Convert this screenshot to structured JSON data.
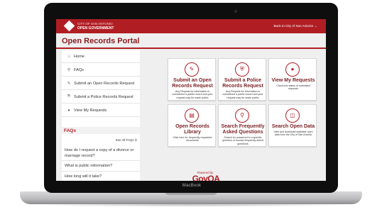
{
  "header": {
    "logo_line1": "CITY OF SAN ANTONIO",
    "logo_line2": "OPEN GOVERNMENT",
    "back_link": "Back to City of San Antonio →"
  },
  "page_title": "Open Records Portal",
  "nav": [
    {
      "icon": "home-icon",
      "label": "Home"
    },
    {
      "icon": "search-icon",
      "label": "FAQs"
    },
    {
      "icon": "edit-icon",
      "label": "Submit an Open Records Request"
    },
    {
      "icon": "shield-icon",
      "label": "Submit a Police Records Request"
    },
    {
      "icon": "user-icon",
      "label": "View My Requests"
    }
  ],
  "faqs": {
    "title": "FAQs",
    "see_all": "See All FAQs",
    "questions": [
      "How do I request a copy of a divorce or marriage record?",
      "What is public information?",
      "How long will it take?"
    ]
  },
  "tiles": [
    {
      "icon": "edit-icon",
      "title": "Submit an Open Records Request",
      "desc": "Any Request for information is considered a public record and your request may be made public"
    },
    {
      "icon": "shield-icon",
      "title": "Submit a Police Records Request",
      "desc": "Any Request for information is considered a public record and your request may be made public"
    },
    {
      "icon": "user-icon",
      "title": "View My Requests",
      "desc": "Check the status of submitted requests"
    },
    {
      "icon": "document-icon",
      "title": "Open Records Library",
      "desc": "Click here for frequently requested documents"
    },
    {
      "icon": "search-icon",
      "title": "Search Frequently Asked Questions",
      "desc": "Search for answered to a specific question or browse frequently asked questions"
    },
    {
      "icon": "database-icon",
      "title": "Search Open Data",
      "desc": "View and download available open data from the City of San Antonio"
    }
  ],
  "footer": {
    "powered_by": "Powered by",
    "logo": "GovQA"
  },
  "device_label": "MacBook",
  "colors": {
    "accent": "#b01e24",
    "title": "#8c1a1f",
    "background": "#efefef"
  }
}
